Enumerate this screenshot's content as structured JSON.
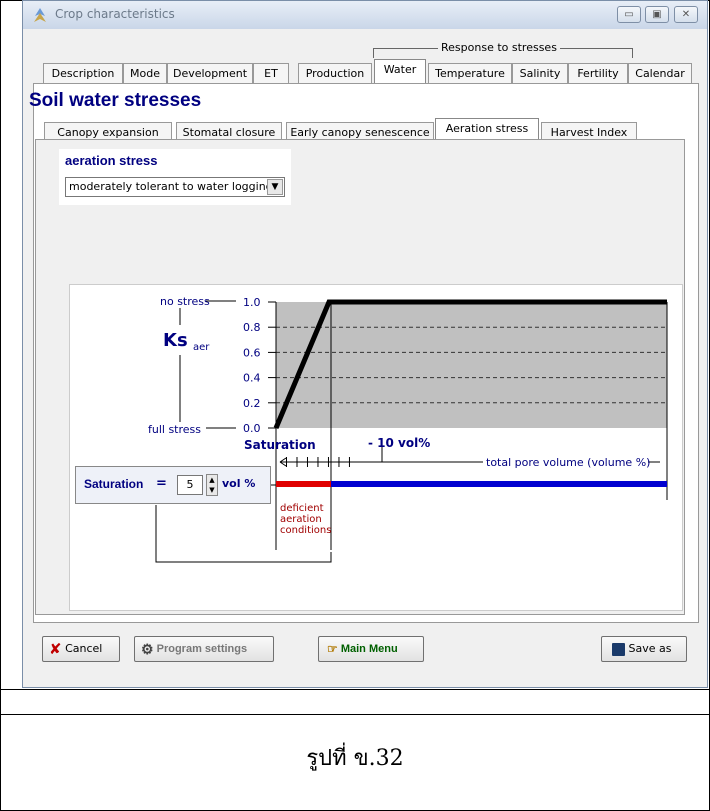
{
  "window": {
    "title": "Crop characteristics",
    "minimize_icon": "minimize-icon",
    "maximize_icon": "maximize-icon",
    "close_icon": "close-icon"
  },
  "group_label": "Response to stresses",
  "tabs": [
    "Description",
    "Mode",
    "Development",
    "ET",
    "Production",
    "Water",
    "Temperature",
    "Salinity",
    "Fertility",
    "Calendar"
  ],
  "active_tab": "Water",
  "page_heading": "Soil water stresses",
  "subtabs": [
    "Canopy expansion",
    "Stomatal closure",
    "Early canopy senescence",
    "Aeration stress",
    "Harvest Index"
  ],
  "active_subtab": "Aeration stress",
  "aeration": {
    "label": "aeration stress",
    "selected": "moderately tolerant to water logging"
  },
  "chart": {
    "no_stress": "no stress",
    "full_stress": "full stress",
    "ks": "Ks",
    "ks_sub": "aer",
    "saturation_label": "Saturation",
    "ten_vol": "- 10 vol%",
    "total_pore": "total pore volume  (volume %)",
    "deficient": [
      "deficient",
      "aeration",
      "conditions"
    ],
    "colors": {
      "deficient_bar": "#e00000",
      "ok_bar": "#0000d0",
      "stress_area": "#c0c0c0",
      "label_blue": "#000080",
      "deficient_text": "#a00000"
    }
  },
  "chart_data": {
    "type": "line",
    "title": "",
    "xlabel": "total pore volume  (volume %)",
    "ylabel": "Ks aer",
    "yticks": [
      "0.0",
      "0.2",
      "0.4",
      "0.6",
      "0.8",
      "1.0"
    ],
    "ylim": [
      0,
      1
    ],
    "x_direction": "decreasing from saturation",
    "series": [
      {
        "x": [
          0,
          5,
          40
        ],
        "y": [
          0.0,
          1.0,
          1.0
        ]
      }
    ],
    "grid": true
  },
  "saturation_input": {
    "label": "Saturation",
    "equals": "=",
    "value": "5",
    "unit": "vol %"
  },
  "buttons": {
    "cancel": "Cancel",
    "program_settings": "Program settings",
    "main_menu": "Main Menu",
    "save_as": "Save as"
  },
  "caption": "รูปที่ ข.32"
}
